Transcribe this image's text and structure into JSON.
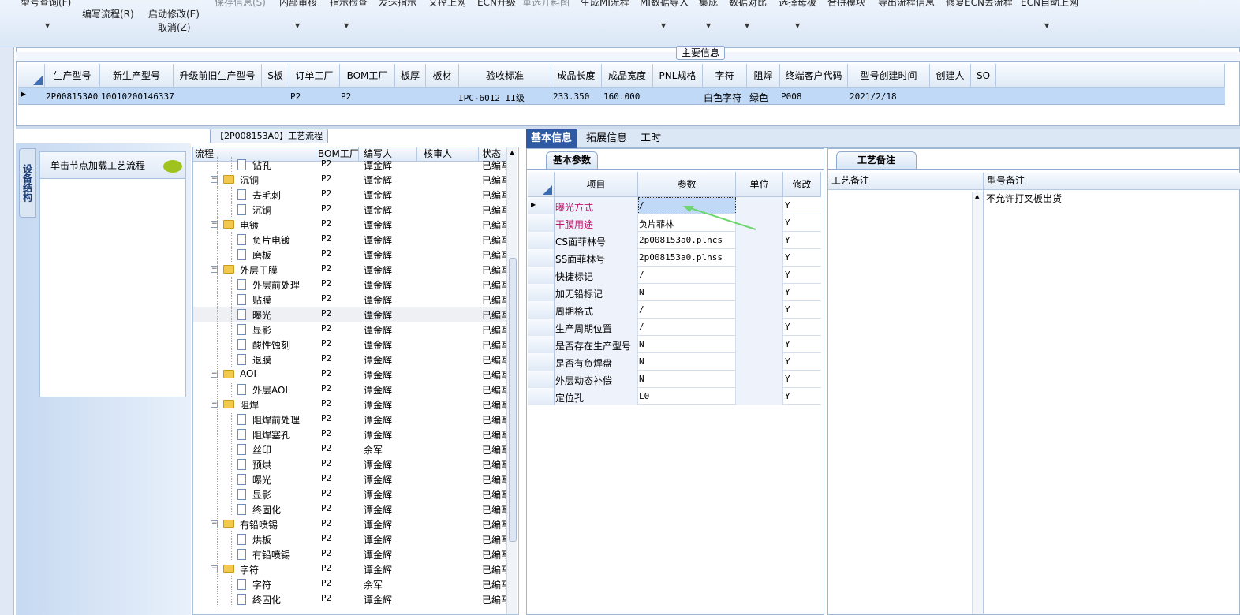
{
  "ribbon": {
    "items": [
      {
        "label": "型号查询(F)"
      },
      {
        "label": "编写流程(R)"
      },
      {
        "label": "启动修改(E)"
      },
      {
        "label": "取消(Z)"
      },
      {
        "label": "保存信息(S)"
      },
      {
        "label": "内部审核"
      },
      {
        "label": "指示检查"
      },
      {
        "label": "发送指示"
      },
      {
        "label": "文控上网"
      },
      {
        "label": "ECN升级"
      },
      {
        "label": "重选开料图"
      },
      {
        "label": "生成MI流程"
      },
      {
        "label": "MI数据导入"
      },
      {
        "label": "集成"
      },
      {
        "label": "数据对比"
      },
      {
        "label": "选择母板"
      },
      {
        "label": "合拼模块"
      },
      {
        "label": "导出流程信息"
      },
      {
        "label": "修复ECN丢流程"
      },
      {
        "label": "ECN自动上网"
      }
    ]
  },
  "main_section": {
    "title": "主要信息",
    "columns": [
      "生产型号",
      "新生产型号",
      "升级前旧生产型号",
      "S板",
      "订单工厂",
      "BOM工厂",
      "板厚",
      "板材",
      "验收标准",
      "成品长度",
      "成品宽度",
      "PNL规格",
      "字符",
      "阻焊",
      "终端客户代码",
      "型号创建时间",
      "创建人",
      "SO"
    ],
    "row": {
      "prod_no": "2P008153A0",
      "new_prod_no": "10010200146337",
      "order_factory": "P2",
      "bom_factory": "P2",
      "standard": "IPC-6012 II级",
      "length": "233.350",
      "width": "160.000",
      "legend": "白色字符",
      "mask": "绿色",
      "customer": "P008",
      "created": "2021/2/18"
    }
  },
  "flow_tab": "【2P008153A0】工艺流程",
  "side_tab": "设备结构",
  "load_hint": "单击节点加载工艺流程",
  "tree": {
    "headers": [
      "流程",
      "BOM工厂",
      "编写人",
      "核审人",
      "状态"
    ],
    "rows": [
      {
        "name": "钻孔",
        "bom": "P2",
        "author": "谭金辉",
        "status": "已编写",
        "type": "doc"
      },
      {
        "name": "沉铜",
        "bom": "P2",
        "author": "谭金辉",
        "status": "已编写",
        "type": "folder"
      },
      {
        "name": "去毛刺",
        "bom": "P2",
        "author": "谭金辉",
        "status": "已编写",
        "type": "doc"
      },
      {
        "name": "沉铜",
        "bom": "P2",
        "author": "谭金辉",
        "status": "已编写",
        "type": "doc"
      },
      {
        "name": "电镀",
        "bom": "P2",
        "author": "谭金辉",
        "status": "已编写",
        "type": "folder"
      },
      {
        "name": "负片电镀",
        "bom": "P2",
        "author": "谭金辉",
        "status": "已编写",
        "type": "doc"
      },
      {
        "name": "磨板",
        "bom": "P2",
        "author": "谭金辉",
        "status": "已编写",
        "type": "doc"
      },
      {
        "name": "外层干膜",
        "bom": "P2",
        "author": "谭金辉",
        "status": "已编写",
        "type": "folder"
      },
      {
        "name": "外层前处理",
        "bom": "P2",
        "author": "谭金辉",
        "status": "已编写",
        "type": "doc"
      },
      {
        "name": "贴膜",
        "bom": "P2",
        "author": "谭金辉",
        "status": "已编写",
        "type": "doc"
      },
      {
        "name": "曝光",
        "bom": "P2",
        "author": "谭金辉",
        "status": "已编写",
        "type": "doc",
        "selected": true
      },
      {
        "name": "显影",
        "bom": "P2",
        "author": "谭金辉",
        "status": "已编写",
        "type": "doc"
      },
      {
        "name": "酸性蚀刻",
        "bom": "P2",
        "author": "谭金辉",
        "status": "已编写",
        "type": "doc"
      },
      {
        "name": "退膜",
        "bom": "P2",
        "author": "谭金辉",
        "status": "已编写",
        "type": "doc"
      },
      {
        "name": "AOI",
        "bom": "P2",
        "author": "谭金辉",
        "status": "已编写",
        "type": "folder"
      },
      {
        "name": "外层AOI",
        "bom": "P2",
        "author": "谭金辉",
        "status": "已编写",
        "type": "doc"
      },
      {
        "name": "阻焊",
        "bom": "P2",
        "author": "谭金辉",
        "status": "已编写",
        "type": "folder"
      },
      {
        "name": "阻焊前处理",
        "bom": "P2",
        "author": "谭金辉",
        "status": "已编写",
        "type": "doc"
      },
      {
        "name": "阻焊塞孔",
        "bom": "P2",
        "author": "谭金辉",
        "status": "已编写",
        "type": "doc"
      },
      {
        "name": "丝印",
        "bom": "P2",
        "author": "余军",
        "status": "已编写",
        "type": "doc"
      },
      {
        "name": "预烘",
        "bom": "P2",
        "author": "谭金辉",
        "status": "已编写",
        "type": "doc"
      },
      {
        "name": "曝光",
        "bom": "P2",
        "author": "谭金辉",
        "status": "已编写",
        "type": "doc"
      },
      {
        "name": "显影",
        "bom": "P2",
        "author": "谭金辉",
        "status": "已编写",
        "type": "doc"
      },
      {
        "name": "终固化",
        "bom": "P2",
        "author": "谭金辉",
        "status": "已编写",
        "type": "doc"
      },
      {
        "name": "有铅喷锡",
        "bom": "P2",
        "author": "谭金辉",
        "status": "已编写",
        "type": "folder"
      },
      {
        "name": "烘板",
        "bom": "P2",
        "author": "谭金辉",
        "status": "已编写",
        "type": "doc"
      },
      {
        "name": "有铅喷锡",
        "bom": "P2",
        "author": "谭金辉",
        "status": "已编写",
        "type": "doc"
      },
      {
        "name": "字符",
        "bom": "P2",
        "author": "谭金辉",
        "status": "已编写",
        "type": "folder"
      },
      {
        "name": "字符",
        "bom": "P2",
        "author": "余军",
        "status": "已编写",
        "type": "doc"
      },
      {
        "name": "终固化",
        "bom": "P2",
        "author": "谭金辉",
        "status": "已编写",
        "type": "doc"
      }
    ]
  },
  "right_tabs": [
    "基本信息",
    "拓展信息",
    "工时"
  ],
  "basic": {
    "subtab": "基本参数",
    "headers": [
      "项目",
      "参数",
      "单位",
      "修改"
    ],
    "rows": [
      {
        "item": "曝光方式",
        "param": "/",
        "mod": "Y",
        "red": true
      },
      {
        "item": "干膜用途",
        "param": "负片菲林",
        "mod": "Y",
        "red": true
      },
      {
        "item": "CS面菲林号",
        "param": "2p008153a0.plncs",
        "mod": "Y"
      },
      {
        "item": "SS面菲林号",
        "param": "2p008153a0.plnss",
        "mod": "Y"
      },
      {
        "item": "快捷标记",
        "param": "/",
        "mod": "Y"
      },
      {
        "item": "加无铅标记",
        "param": "N",
        "mod": "Y"
      },
      {
        "item": "周期格式",
        "param": "/",
        "mod": "Y"
      },
      {
        "item": "生产周期位置",
        "param": "/",
        "mod": "Y"
      },
      {
        "item": "是否存在生产型号",
        "param": "N",
        "mod": "Y"
      },
      {
        "item": "是否有负焊盘",
        "param": "N",
        "mod": "Y"
      },
      {
        "item": "外层动态补偿",
        "param": "N",
        "mod": "Y"
      },
      {
        "item": "定位孔",
        "param": "L0",
        "mod": "Y"
      }
    ]
  },
  "remarks": {
    "tab": "工艺备注",
    "col1": "工艺备注",
    "col2": "型号备注",
    "model_note": "不允许打叉板出货"
  },
  "colors": {
    "accent": "#2d5aa3",
    "selection": "#bfd9f6",
    "red_text": "#c0146c"
  }
}
